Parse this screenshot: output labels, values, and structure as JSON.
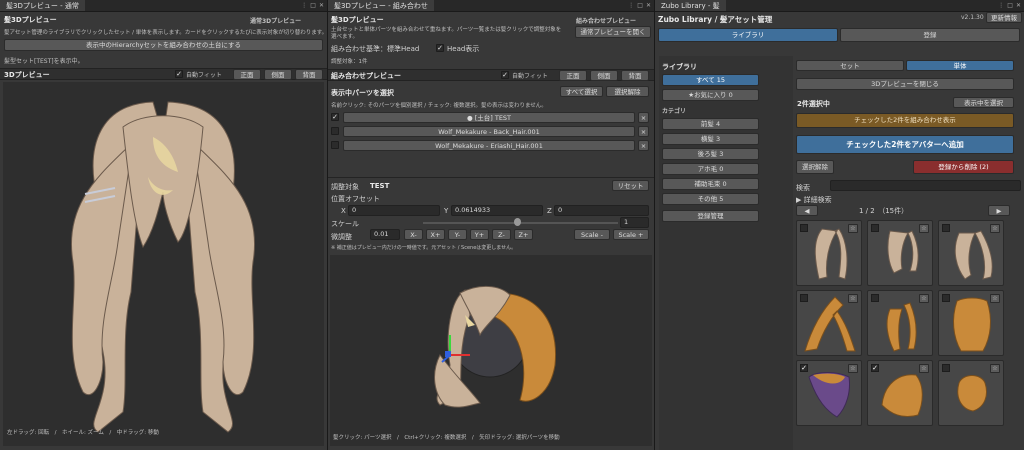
{
  "panel1": {
    "tab": "髪3Dプレビュー - 通常",
    "title": "髪3Dプレビュー",
    "mode_label": "通常3Dプレビュー",
    "desc": "髪アセット管理のライブラリでクリックしたセット / 単体を表示します。カードをクリックするたびに表示対象が切り替わります。",
    "combine_button": "表示中のHierarchyセットを組み合わせの土台にする",
    "status": "髪型セット[TEST]を表示中。",
    "preview_label": "3Dプレビュー",
    "autofit": "自動フィット",
    "view_front": "正面",
    "view_side": "側面",
    "view_back": "背面",
    "hint": "左ドラッグ: 回転　/　ホイール: ズーム　/　中ドラッグ: 移動"
  },
  "panel2": {
    "tab": "髪3Dプレビュー - 組み合わせ",
    "title": "髪3Dプレビュー",
    "mode_label": "組み合わせプレビュー",
    "desc": "土台セットと単体パーツを組み合わせて重ねます。パーツ一覧または髪クリックで調整対象を選べます。",
    "normal_preview_button": "通常プレビューを開く",
    "base_label": "組み合わせ基準：標準Head",
    "head_toggle": "Head表示",
    "adjust_count": "調整対象：1件",
    "combine_preview_label": "組み合わせプレビュー",
    "autofit": "自動フィット",
    "view_front": "正面",
    "view_side": "側面",
    "view_back": "背面",
    "parts_header": "表示中パーツを選択",
    "select_all": "すべて選択",
    "deselect": "選択解除",
    "parts_desc": "名前クリック: そのパーツを個別選択 / チェック: 複数選択。髪の表示は変わりません。",
    "parts": [
      {
        "name": "● [土台] TEST",
        "checked": true
      },
      {
        "name": "Wolf_Mekakure - Back_Hair.001",
        "checked": false
      },
      {
        "name": "Wolf_Mekakure - Eriashi_Hair.001",
        "checked": false
      }
    ],
    "target_label": "調整対象",
    "target_value": "TEST",
    "reset": "リセット",
    "offset_label": "位置オフセット",
    "x_label": "X",
    "x_value": "0",
    "y_label": "Y",
    "y_value": "0.0614933",
    "z_label": "Z",
    "z_value": "0",
    "scale_label": "スケール",
    "scale_value": "1",
    "fine_label": "微調整",
    "fine_value": "0.01",
    "nudge": [
      "X-",
      "X+",
      "Y-",
      "Y+",
      "Z-",
      "Z+"
    ],
    "scale_minus": "Scale -",
    "scale_plus": "Scale +",
    "note": "※ 補正値はプレビュー内だけの一時値です。元アセット / Sceneは変更しません。",
    "hint": "髪クリック: パーツ選択　/　Ctrl+クリック: 複数選択　/　矢印ドラッグ: 選択パーツを移動"
  },
  "panel3": {
    "tab": "Zubo Library - 髪",
    "title": "Zubo Library / 髪アセット管理",
    "version": "v2.1.30",
    "update_info": "更新情報",
    "tab_library": "ライブラリ",
    "tab_register": "登録",
    "library_label": "ライブラリ",
    "all": "すべて 15",
    "favorites": "★お気に入り 0",
    "category_label": "カテゴリ",
    "categories": [
      {
        "label": "前髪 4"
      },
      {
        "label": "横髪 3"
      },
      {
        "label": "後ろ髪 3"
      },
      {
        "label": "アホ毛 0"
      },
      {
        "label": "補助毛束 0"
      },
      {
        "label": "その他 5"
      }
    ],
    "register_manage": "登録管理",
    "seg_set": "セット",
    "seg_single": "単体",
    "close_preview": "3Dプレビューを閉じる",
    "selected_count": "2件選択中",
    "deselect_shown": "表示中を選択",
    "combine_checked": "チェックした2件を組み合わせ表示",
    "add_to_avatar": "チェックした2件をアバターへ追加",
    "clear_selection": "選択解除",
    "remove_from_registry": "登録から削除 (2)",
    "search_label": "検索",
    "advanced_search": "▶ 詳細検索",
    "page_prev": "◀",
    "page_next": "▶",
    "page_info": "1 / 2　（15件）",
    "thumbnails": [
      {
        "checked": false
      },
      {
        "checked": false
      },
      {
        "checked": false
      },
      {
        "checked": false
      },
      {
        "checked": false
      },
      {
        "checked": false
      },
      {
        "checked": true
      },
      {
        "checked": true
      },
      {
        "checked": false
      }
    ],
    "star": "☆",
    "colors": {
      "accent_blue": "#3f6f9b",
      "warn_orange": "#7a5a25",
      "danger_red": "#8a2e2e"
    }
  }
}
